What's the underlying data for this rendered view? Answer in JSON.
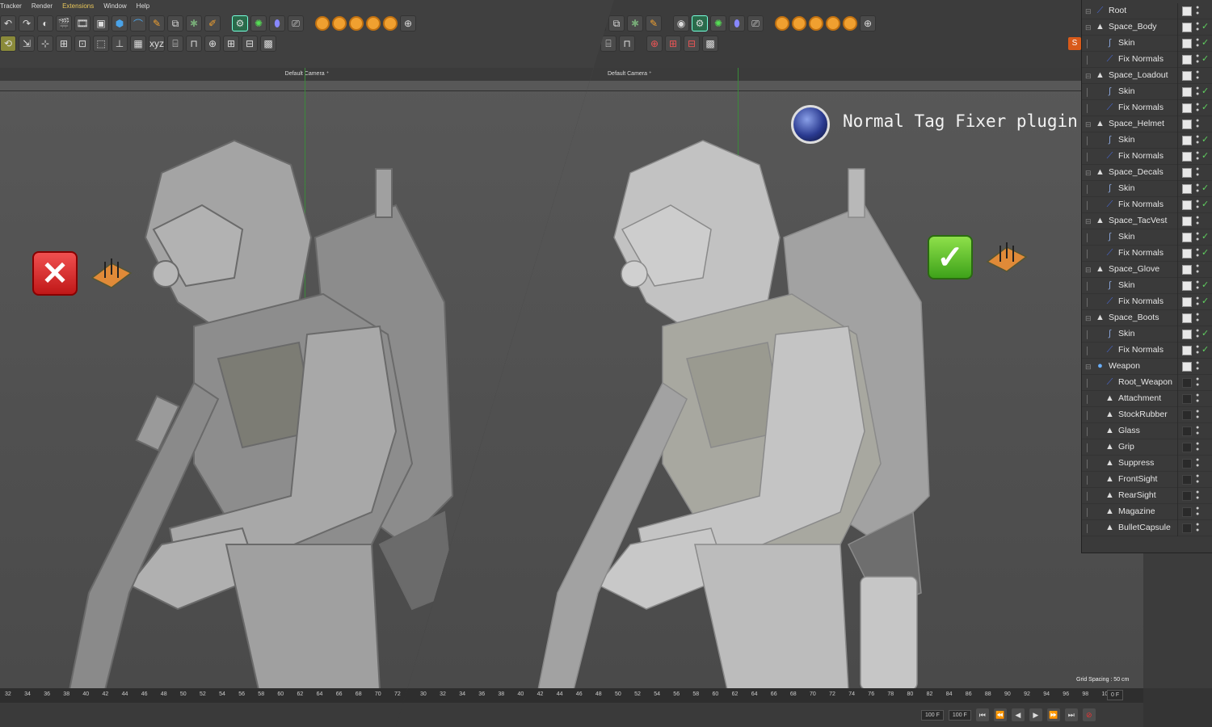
{
  "menu": {
    "items": [
      "Tracker",
      "Render",
      "Extensions",
      "Window",
      "Help"
    ]
  },
  "viewport": {
    "left_camera": "Default Camera",
    "right_camera": "Default Camera",
    "grid_spacing": "Grid Spacing : 50 cm"
  },
  "overlay": {
    "plugin_title": "Normal Tag Fixer plugin",
    "bad_icon": "red-x-icon",
    "good_icon": "green-check-icon",
    "tag_icon": "normal-tag-icon",
    "logo_icon": "cinema4d-logo-icon"
  },
  "timeline": {
    "left_ticks": [
      "32",
      "34",
      "36",
      "38",
      "40",
      "42",
      "44",
      "46",
      "48",
      "50",
      "52",
      "54",
      "56",
      "58",
      "60",
      "62",
      "64",
      "66",
      "68",
      "70",
      "72"
    ],
    "right_ticks": [
      "30",
      "32",
      "34",
      "36",
      "38",
      "40",
      "42",
      "44",
      "46",
      "48",
      "50",
      "52",
      "54",
      "56",
      "58",
      "60",
      "62",
      "64",
      "66",
      "68",
      "70",
      "72",
      "74",
      "76",
      "78",
      "80",
      "82",
      "84",
      "86",
      "88",
      "90",
      "92",
      "94",
      "96",
      "98",
      "100"
    ],
    "frame_display": "0 F",
    "end_frame_left": "100 F",
    "end_frame_right": "100 F"
  },
  "object_manager": {
    "rows": [
      {
        "label": "Root",
        "depth": 0,
        "icon": "joint-icon",
        "visible": true,
        "check": false
      },
      {
        "label": "Space_Body",
        "depth": 0,
        "icon": "polygon-object-icon",
        "visible": true,
        "check": true
      },
      {
        "label": "Skin",
        "depth": 1,
        "icon": "skin-deformer-icon",
        "visible": true,
        "check": true
      },
      {
        "label": "Fix Normals",
        "depth": 1,
        "icon": "fix-normals-icon",
        "visible": true,
        "check": true
      },
      {
        "label": "Space_Loadout",
        "depth": 0,
        "icon": "polygon-object-icon",
        "visible": true,
        "check": false
      },
      {
        "label": "Skin",
        "depth": 1,
        "icon": "skin-deformer-icon",
        "visible": true,
        "check": true
      },
      {
        "label": "Fix Normals",
        "depth": 1,
        "icon": "fix-normals-icon",
        "visible": true,
        "check": true
      },
      {
        "label": "Space_Helmet",
        "depth": 0,
        "icon": "polygon-object-icon",
        "visible": true,
        "check": false
      },
      {
        "label": "Skin",
        "depth": 1,
        "icon": "skin-deformer-icon",
        "visible": true,
        "check": true
      },
      {
        "label": "Fix Normals",
        "depth": 1,
        "icon": "fix-normals-icon",
        "visible": true,
        "check": true
      },
      {
        "label": "Space_Decals",
        "depth": 0,
        "icon": "polygon-object-icon",
        "visible": true,
        "check": false
      },
      {
        "label": "Skin",
        "depth": 1,
        "icon": "skin-deformer-icon",
        "visible": true,
        "check": true
      },
      {
        "label": "Fix Normals",
        "depth": 1,
        "icon": "fix-normals-icon",
        "visible": true,
        "check": true
      },
      {
        "label": "Space_TacVest",
        "depth": 0,
        "icon": "polygon-object-icon",
        "visible": true,
        "check": false
      },
      {
        "label": "Skin",
        "depth": 1,
        "icon": "skin-deformer-icon",
        "visible": true,
        "check": true
      },
      {
        "label": "Fix Normals",
        "depth": 1,
        "icon": "fix-normals-icon",
        "visible": true,
        "check": true
      },
      {
        "label": "Space_Glove",
        "depth": 0,
        "icon": "polygon-object-icon",
        "visible": true,
        "check": false
      },
      {
        "label": "Skin",
        "depth": 1,
        "icon": "skin-deformer-icon",
        "visible": true,
        "check": true
      },
      {
        "label": "Fix Normals",
        "depth": 1,
        "icon": "fix-normals-icon",
        "visible": true,
        "check": true
      },
      {
        "label": "Space_Boots",
        "depth": 0,
        "icon": "polygon-object-icon",
        "visible": true,
        "check": false
      },
      {
        "label": "Skin",
        "depth": 1,
        "icon": "skin-deformer-icon",
        "visible": true,
        "check": true
      },
      {
        "label": "Fix Normals",
        "depth": 1,
        "icon": "fix-normals-icon",
        "visible": true,
        "check": true
      },
      {
        "label": "Weapon",
        "depth": 0,
        "icon": "null-object-icon",
        "visible": true,
        "check": false
      },
      {
        "label": "Root_Weapon",
        "depth": 1,
        "icon": "joint-icon",
        "visible": false,
        "check": false
      },
      {
        "label": "Attachment",
        "depth": 1,
        "icon": "polygon-object-icon",
        "visible": false,
        "check": false
      },
      {
        "label": "StockRubber",
        "depth": 1,
        "icon": "polygon-object-icon",
        "visible": false,
        "check": false
      },
      {
        "label": "Glass",
        "depth": 1,
        "icon": "polygon-object-icon",
        "visible": false,
        "check": false
      },
      {
        "label": "Grip",
        "depth": 1,
        "icon": "polygon-object-icon",
        "visible": false,
        "check": false
      },
      {
        "label": "Suppress",
        "depth": 1,
        "icon": "polygon-object-icon",
        "visible": false,
        "check": false
      },
      {
        "label": "FrontSight",
        "depth": 1,
        "icon": "polygon-object-icon",
        "visible": false,
        "check": false
      },
      {
        "label": "RearSight",
        "depth": 1,
        "icon": "polygon-object-icon",
        "visible": false,
        "check": false
      },
      {
        "label": "Magazine",
        "depth": 1,
        "icon": "polygon-object-icon",
        "visible": false,
        "check": false
      },
      {
        "label": "BulletCapsule",
        "depth": 1,
        "icon": "polygon-object-icon",
        "visible": false,
        "check": false
      }
    ]
  },
  "colors": {
    "accent_orange": "#f0a030",
    "check_green": "#5fd05f",
    "error_red": "#c01818"
  }
}
